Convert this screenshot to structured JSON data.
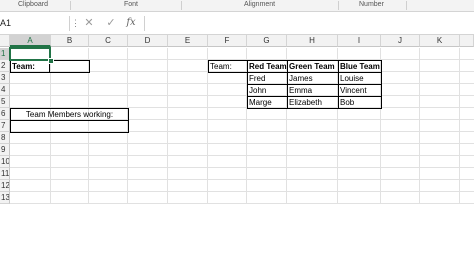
{
  "ribbon": {
    "groups": [
      "Clipboard",
      "Font",
      "Alignment",
      "Number"
    ]
  },
  "formula_bar": {
    "name_box": "A1",
    "cancel_icon": "✕",
    "enter_icon": "✓",
    "fx_label": "fx",
    "formula": ""
  },
  "sheet": {
    "columns": [
      "A",
      "B",
      "C",
      "D",
      "E",
      "F",
      "G",
      "H",
      "I",
      "J",
      "K"
    ],
    "rows": [
      "1",
      "2",
      "3",
      "4",
      "5",
      "6",
      "7",
      "8",
      "9",
      "10",
      "11",
      "12",
      "13"
    ],
    "selected_cell": "A1",
    "cells": {
      "a2": "Team:",
      "a5": "Team Members working:",
      "f2": "Team:",
      "g2": "Red Team",
      "h2": "Green Team",
      "i2": "Blue Team",
      "g3": "Fred",
      "h3": "James",
      "i3": "Louise",
      "g4": "John",
      "h4": "Emma",
      "i4": "Vincent",
      "g5": "Marge",
      "h5": "Elizabeth",
      "i5": "Bob"
    }
  }
}
